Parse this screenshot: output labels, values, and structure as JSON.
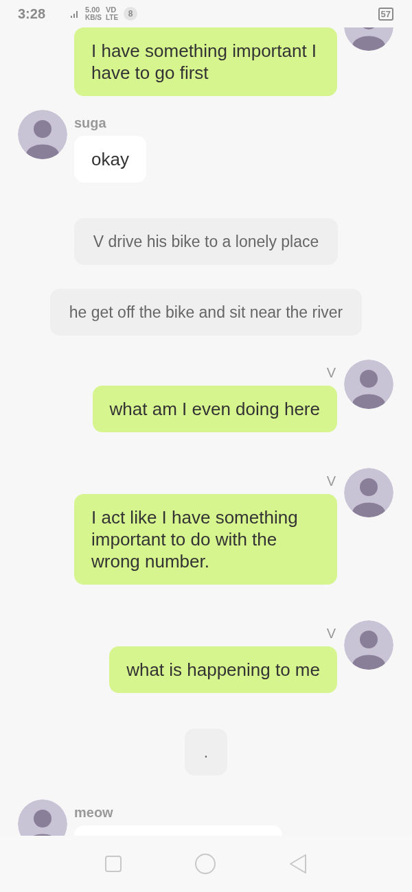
{
  "status_bar": {
    "time": "3:28",
    "speed": "5.00",
    "speed_unit": "KB/S",
    "carrier": "VD",
    "network": "LTE",
    "notification_count": "8",
    "battery": "57"
  },
  "messages": [
    {
      "kind": "outgoing",
      "text": "I have something important I have to go first"
    },
    {
      "kind": "incoming",
      "sender": "suga",
      "text": "okay"
    },
    {
      "kind": "narration",
      "text": "V drive his bike to a lonely place"
    },
    {
      "kind": "narration",
      "text": "he get off the bike and sit near the river"
    },
    {
      "kind": "outgoing",
      "sender": "V",
      "text": "what am I even doing here"
    },
    {
      "kind": "outgoing",
      "sender": "V",
      "text": "I act like I have something important to do with the wrong number."
    },
    {
      "kind": "outgoing",
      "sender": "V",
      "text": "what is happening to me"
    },
    {
      "kind": "narration",
      "text": "."
    },
    {
      "kind": "incoming",
      "sender": "meow"
    }
  ]
}
